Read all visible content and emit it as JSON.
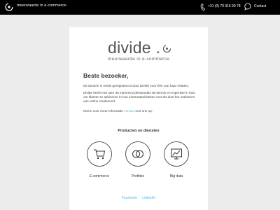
{
  "header": {
    "tagline": "meerwaarde in e-commerce",
    "phone": "+31 (0) 79 316 90 78",
    "contact_label": "Contact",
    "logo_icon": "divide-logo-icon",
    "phone_icon": "phone-icon",
    "chat_icon": "chat-bubble-icon"
  },
  "brand": {
    "name": "divide .",
    "tagline": "meerwaarde in e-commerce"
  },
  "content": {
    "greeting": "Beste bezoeker,",
    "p1": "Dit domein is reeds geregistreerd door Divide voor één van haar relaties.",
    "p2": "Divide heeft met ruim 30 internet professionals de kennis en expertise in huis om klanten te adviseren in hun internetactiviteiten met als doel het realiseren van online rendement.",
    "p3_before": "Neem voor meer informatie",
    "p3_link": "contact",
    "p3_after": "met ons op."
  },
  "services": {
    "title": "Producten en diensten",
    "items": [
      {
        "label": "E-commerce",
        "icon": "shopping-cart-icon"
      },
      {
        "label": "Portfolio",
        "icon": "portfolio-rings-icon"
      },
      {
        "label": "Big data",
        "icon": "chart-monitor-icon"
      }
    ]
  },
  "social": {
    "facebook": "Facebook",
    "linkedin": "LinkedIn"
  },
  "colors": {
    "topbar": "#000000",
    "background": "#ececec",
    "link": "#5ab4e0"
  }
}
